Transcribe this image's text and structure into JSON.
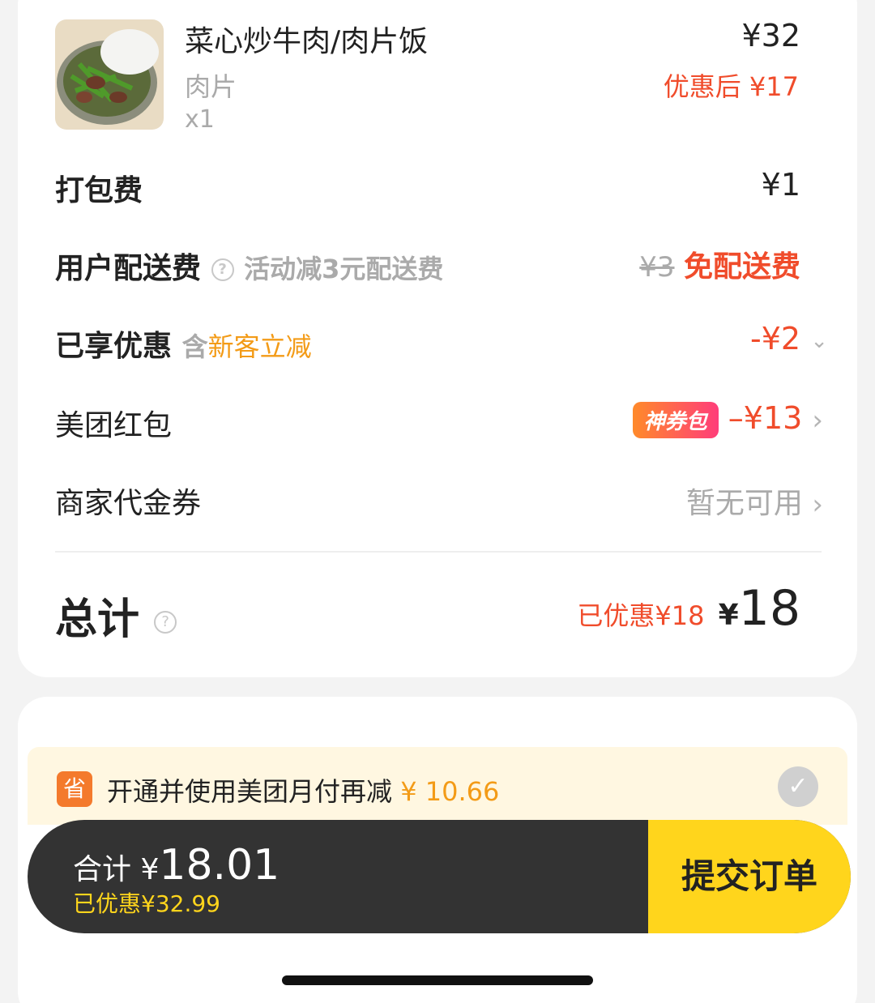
{
  "product": {
    "name": "菜心炒牛肉/肉片饭",
    "spec": "肉片",
    "qty": "x1",
    "price": "¥32",
    "discounted": "优惠后 ¥17"
  },
  "packing": {
    "label": "打包费",
    "value": "¥1"
  },
  "delivery": {
    "label": "用户配送费",
    "note": "活动减3元配送费",
    "old_price": "¥3",
    "value": "免配送费"
  },
  "discounts": {
    "label": "已享优惠",
    "prefix": "含",
    "tag": "新客立减",
    "value": "-¥2"
  },
  "red_packet": {
    "label": "美团红包",
    "badge": "神券包",
    "value": "–¥13"
  },
  "voucher": {
    "label": "商家代金券",
    "value": "暂无可用"
  },
  "total": {
    "label": "总计",
    "saved": "已优惠¥18",
    "currency": "¥",
    "amount": "18"
  },
  "promo": {
    "icon_text": "省",
    "text": "开通并使用美团月付再减",
    "amount": "¥ 10.66"
  },
  "bottom": {
    "total_label": "合计",
    "total_currency": "¥",
    "total_amount": "18.01",
    "saved": "已优惠¥32.99",
    "submit": "提交订单"
  }
}
